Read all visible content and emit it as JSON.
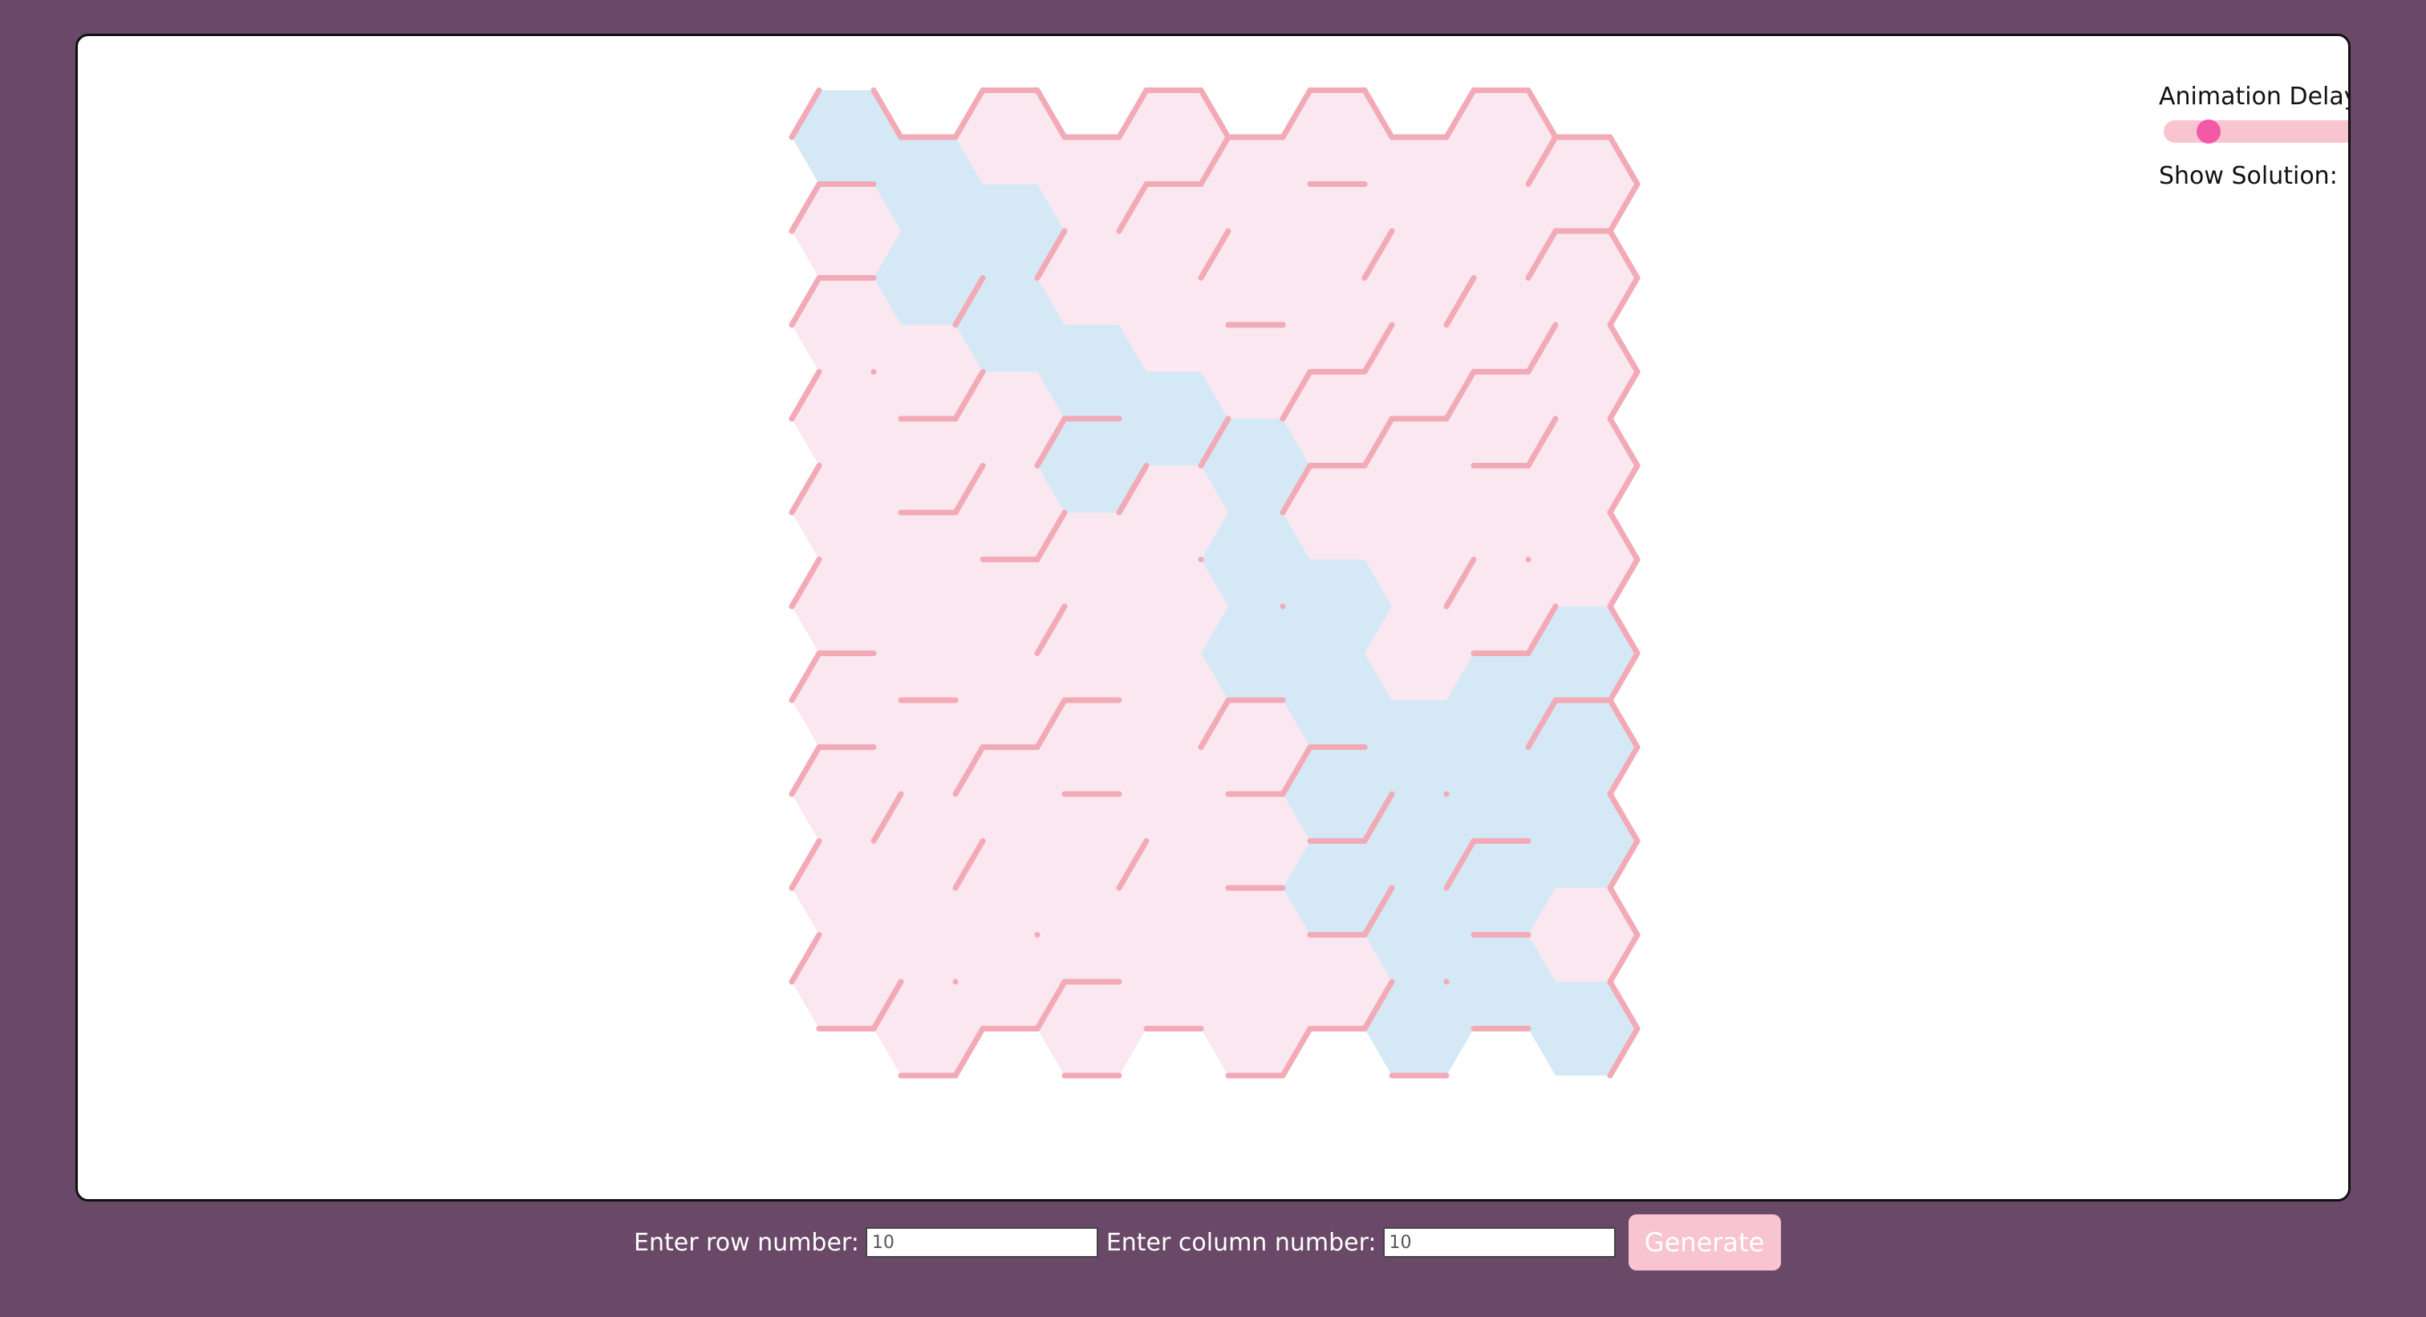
{
  "controls": {
    "animation_delay_label": "Animation Delay:",
    "animation_delay_value": 0.15,
    "show_solution_label": "Show Solution:",
    "show_solution_checked": true,
    "checkmark_glyph": "✓"
  },
  "form": {
    "row_label": "Enter row number:",
    "row_value": "10",
    "column_label": "Enter column number:",
    "column_value": "10",
    "generate_label": "Generate"
  },
  "maze": {
    "rows": 10,
    "columns": 10,
    "solution_cells": [
      [
        0,
        0
      ],
      [
        0,
        1
      ],
      [
        1,
        1
      ],
      [
        1,
        2
      ],
      [
        2,
        2
      ],
      [
        2,
        3
      ],
      [
        3,
        3
      ],
      [
        3,
        4
      ],
      [
        3,
        5
      ],
      [
        4,
        5
      ],
      [
        5,
        5
      ],
      [
        5,
        6
      ],
      [
        6,
        6
      ],
      [
        6,
        7
      ],
      [
        7,
        7
      ],
      [
        7,
        8
      ],
      [
        7,
        9
      ],
      [
        6,
        9
      ],
      [
        5,
        9
      ],
      [
        6,
        8
      ],
      [
        7,
        6
      ],
      [
        8,
        6
      ],
      [
        8,
        7
      ],
      [
        8,
        8
      ],
      [
        9,
        8
      ],
      [
        9,
        9
      ],
      [
        9,
        7
      ]
    ],
    "colors": {
      "cell_fill": "#fbe7ef",
      "solution_fill": "#d5e8f5",
      "wall": "#f2aab6",
      "page_background": "#6a4868",
      "accent": "#f25aa8"
    }
  }
}
